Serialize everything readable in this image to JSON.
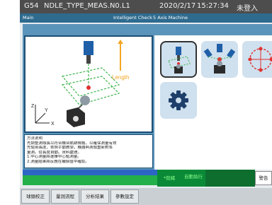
{
  "titlebar": {
    "mode": "G54",
    "program": "NDLE_TYPE_MEAS.N0.L1",
    "date": "2020/2/17",
    "time": "15:27:34",
    "status": "未登入"
  },
  "subbar": {
    "left": "Main",
    "center": "Intelligent Check",
    "right": "5 Axis Machine"
  },
  "diagram": {
    "length_label": "Length",
    "axis_z": "Z",
    "axis_y": "Y",
    "axis_x": "X"
  },
  "info": {
    "lines": [
      "方法说明",
      "先調整測頭長以符合機台軌跡規格，以確保測量有效",
      "先使用長度，依照手動教學，機器與測頭重新對準",
      "量測。從長度自動。資料處理。",
      "1.中心測量將選擇中心點測量。",
      "2.測量結果將反應在補償值中確認。"
    ]
  },
  "tiles": [
    {
      "name": "probe-length-tile",
      "selected": true
    },
    {
      "name": "multi-angle-probe-tile",
      "selected": false
    },
    {
      "name": "center-measure-tile",
      "selected": false
    },
    {
      "name": "settings-tile",
      "selected": false
    }
  ],
  "status": {
    "run_state": "*就緒",
    "mode_label": "自動執行",
    "alarm": "警告"
  },
  "softkeys": [
    "球頭校正",
    "量測流程",
    "分析結果",
    "參數設定"
  ],
  "colors": {
    "titlebar_bg": "#4d4d4d",
    "subbar_bg": "#2f6b8f",
    "content_bg": "#5b94ba",
    "tile_bg": "#cfe0ee",
    "status_blue": "#2c65c4",
    "status_green": "#23b04a"
  }
}
